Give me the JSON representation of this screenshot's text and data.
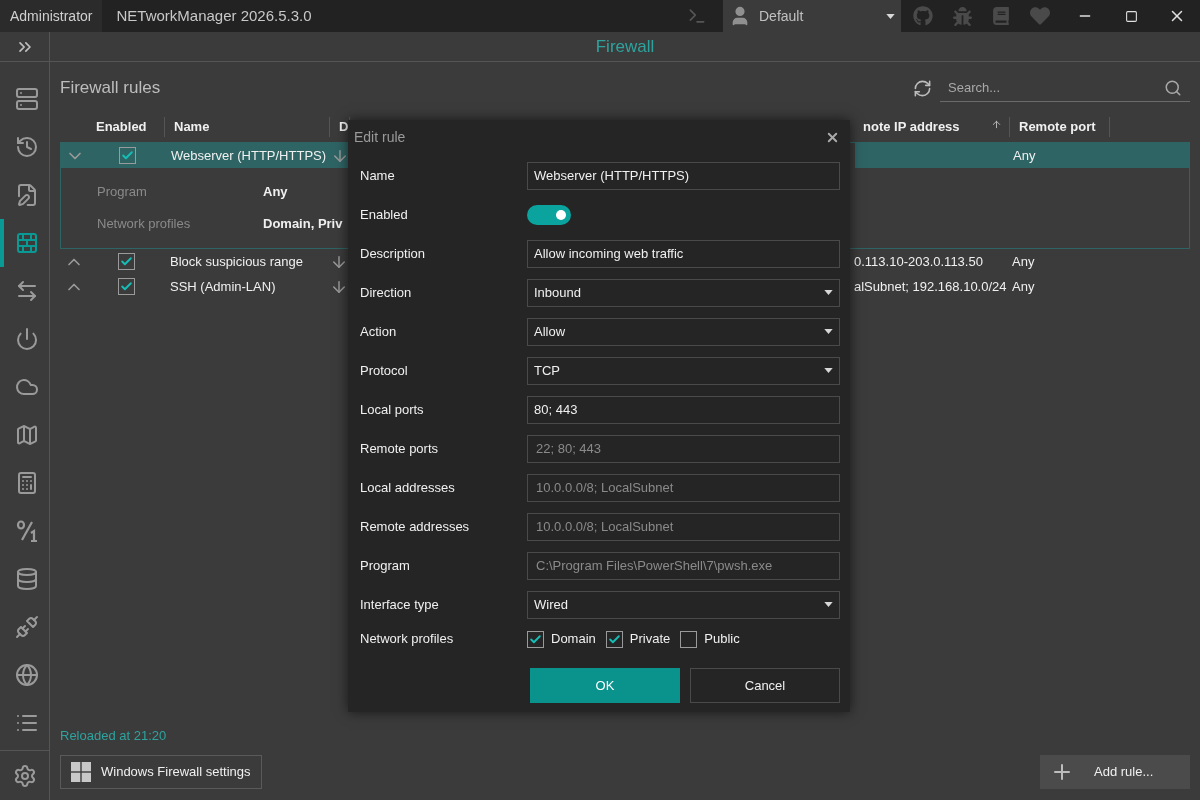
{
  "titlebar": {
    "user": "Administrator",
    "app_title": "NETworkManager 2026.5.3.0",
    "profile": "Default"
  },
  "sidebar": {
    "items": [
      {
        "kind": "server",
        "selected": false
      },
      {
        "kind": "history",
        "selected": false
      },
      {
        "kind": "document",
        "selected": false
      },
      {
        "kind": "firewall",
        "selected": true
      },
      {
        "kind": "transfer",
        "selected": false
      },
      {
        "kind": "power",
        "selected": false
      },
      {
        "kind": "cloud",
        "selected": false
      },
      {
        "kind": "map",
        "selected": false
      },
      {
        "kind": "calculator",
        "selected": false
      },
      {
        "kind": "subnet",
        "selected": false
      },
      {
        "kind": "database",
        "selected": false
      },
      {
        "kind": "plug",
        "selected": false
      },
      {
        "kind": "globe",
        "selected": false
      },
      {
        "kind": "list",
        "selected": false
      }
    ]
  },
  "header": {
    "title": "Firewall"
  },
  "panel": {
    "title": "Firewall rules",
    "search": {
      "placeholder": "Search..."
    }
  },
  "table": {
    "columns": [
      {
        "label": "Enabled",
        "sorted": false
      },
      {
        "label": "Name",
        "sorted": false
      },
      {
        "label": "D",
        "sorted": false
      },
      {
        "label": "note IP address",
        "sorted": true
      },
      {
        "label": "Remote port",
        "sorted": false
      }
    ],
    "rows": [
      {
        "expanded": true,
        "selected": true,
        "enabled": true,
        "name": "Webserver (HTTP/HTTPS)",
        "remote_ip": "",
        "remote_port": "Any",
        "details": [
          {
            "label": "Program",
            "value": "Any"
          },
          {
            "label": "Network profiles",
            "value": "Domain, Priv"
          }
        ]
      },
      {
        "expanded": false,
        "selected": false,
        "enabled": true,
        "name": "Block suspicious range",
        "remote_ip": "0.113.10-203.0.113.50",
        "remote_port": "Any",
        "details": []
      },
      {
        "expanded": false,
        "selected": false,
        "enabled": true,
        "name": "SSH (Admin-LAN)",
        "remote_ip": "alSubnet; 192.168.10.0/24",
        "remote_port": "Any",
        "details": []
      }
    ]
  },
  "dialog": {
    "title": "Edit rule",
    "fields": [
      {
        "kind": "text",
        "label": "Name",
        "value": "Webserver (HTTP/HTTPS)"
      },
      {
        "kind": "toggle",
        "label": "Enabled",
        "on": true
      },
      {
        "kind": "text",
        "label": "Description",
        "value": "Allow incoming web traffic"
      },
      {
        "kind": "select",
        "label": "Direction",
        "value": "Inbound"
      },
      {
        "kind": "select",
        "label": "Action",
        "value": "Allow"
      },
      {
        "kind": "select",
        "label": "Protocol",
        "value": "TCP"
      },
      {
        "kind": "text",
        "label": "Local ports",
        "value": "80; 443"
      },
      {
        "kind": "text",
        "label": "Remote ports",
        "placeholder": "22; 80; 443"
      },
      {
        "kind": "text",
        "label": "Local addresses",
        "placeholder": "10.0.0.0/8; LocalSubnet"
      },
      {
        "kind": "text",
        "label": "Remote addresses",
        "placeholder": "10.0.0.0/8; LocalSubnet"
      },
      {
        "kind": "text",
        "label": "Program",
        "placeholder": "C:\\Program Files\\PowerShell\\7\\pwsh.exe"
      },
      {
        "kind": "select",
        "label": "Interface type",
        "value": "Wired"
      },
      {
        "kind": "checks",
        "label": "Network profiles",
        "options": [
          {
            "label": "Domain",
            "checked": true
          },
          {
            "label": "Private",
            "checked": true
          },
          {
            "label": "Public",
            "checked": false
          }
        ]
      }
    ],
    "buttons": [
      {
        "label": "OK",
        "primary": true
      },
      {
        "label": "Cancel",
        "primary": false
      }
    ]
  },
  "footer": {
    "status": "Reloaded at 21:20",
    "settings_button": "Windows Firewall settings",
    "add_button": "Add rule..."
  }
}
